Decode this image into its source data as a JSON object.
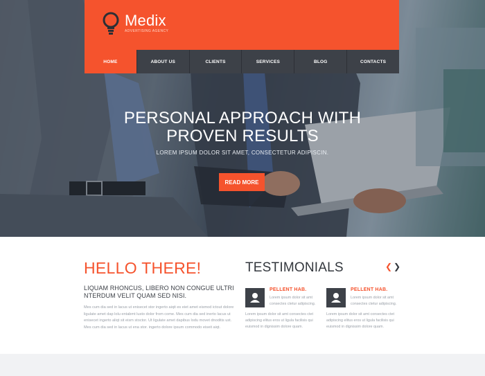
{
  "brand": {
    "name": "Medix",
    "tagline": "ADVERTISING AGENCY",
    "accent_color": "#f5532d",
    "dark_color": "#3d4148",
    "logo_icon": "lightbulb-icon"
  },
  "nav": {
    "items": [
      {
        "label": "HOME",
        "active": true
      },
      {
        "label": "ABOUT US",
        "active": false
      },
      {
        "label": "CLIENTS",
        "active": false
      },
      {
        "label": "SERVICES",
        "active": false
      },
      {
        "label": "BLOG",
        "active": false
      },
      {
        "label": "CONTACTS",
        "active": false
      }
    ]
  },
  "hero": {
    "title_line1": "PERSONAL APPROACH WITH",
    "title_line2": "PROVEN RESULTS",
    "subtitle": "LOREM IPSUM DOLOR SIT AMET, CONSECTETUR ADIPISCIN.",
    "button_label": "READ MORE"
  },
  "hello": {
    "title": "HELLO THERE!",
    "lead": "LIQUAM RHONCUS, LIBERO NON CONGUE ULTRI NTERDUM VELIT QUAM SED NISI.",
    "body": "Mes cum dia sed in lacus ut enisecet stor ingerto aiqit es eiet amet eismod ictout dolore ligulate amet dap lolu entabmt lusto dolor from come. Mes cum dia sed inerto lacus ut enisecet ingerto aliqt sit eism stoctor. Ut ligulate amet dapibus lodu movet dnoditis ust. Mes cum dia sed in lacus ut ena stor. ingerto dolore ipsum commodo eiseit aiqt."
  },
  "testimonials": {
    "title": "TESTIMONIALS",
    "prev_icon": "chevron-left-icon",
    "next_icon": "chevron-right-icon",
    "items": [
      {
        "name": "PELLENT HAB.",
        "short": "Lorem ipsum dolor sit amt consectes ctetur adipiscing.",
        "body": "Lorem ipsum dolor sit amt consectes ctet adipiscing elitus eros ut ligula facilisis qui euismod in dignissim dolore quam.",
        "avatar_icon": "user-icon"
      },
      {
        "name": "PELLENT HAB.",
        "short": "Lorem ipsum dolor sit amt consectes ctetur adipiscing.",
        "body": "Lorem ipsum dolor sit amt consectes ctet adipiscing elitus eros ut ligula facilisis qui euismod in dignissim dolore quam.",
        "avatar_icon": "user-icon"
      }
    ]
  }
}
